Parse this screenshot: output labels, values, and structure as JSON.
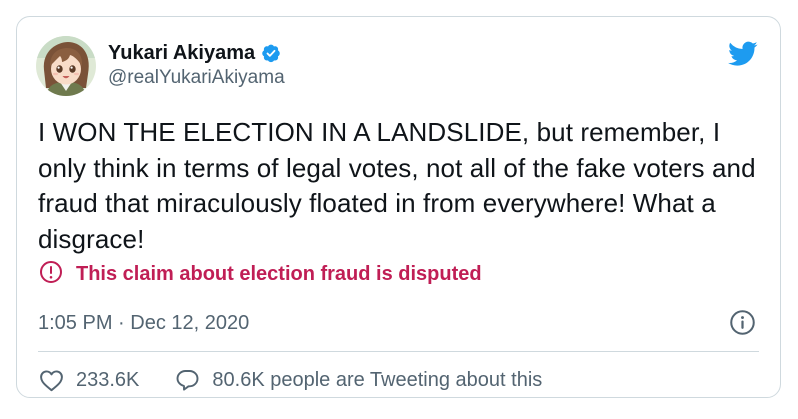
{
  "tweet": {
    "author": {
      "display_name": "Yukari Akiyama",
      "handle": "@realYukariAkiyama",
      "verified": true,
      "avatar": "anime-girl-avatar"
    },
    "text": "I WON THE ELECTION IN A LANDSLIDE, but remember, I only think in terms of legal votes, not all of the fake voters and fraud that miraculously floated in from everywhere! What a disgrace!",
    "disputed_label": "This claim about election fraud is disputed",
    "timestamp": "1:05 PM · Dec 12, 2020",
    "likes": "233.6K",
    "tweeting_about": "80.6K people are Tweeting about this"
  },
  "icons": {
    "brand": "twitter-bird-icon",
    "verified": "verified-badge-icon",
    "disputed": "exclamation-circle-icon",
    "info": "info-icon",
    "like": "heart-icon",
    "reply": "speech-bubble-icon"
  },
  "colors": {
    "brand_blue": "#1d9bf0",
    "text_primary": "#0f1419",
    "text_secondary": "#536471",
    "dispute_red": "#c01e55",
    "border": "#cfd9de"
  }
}
